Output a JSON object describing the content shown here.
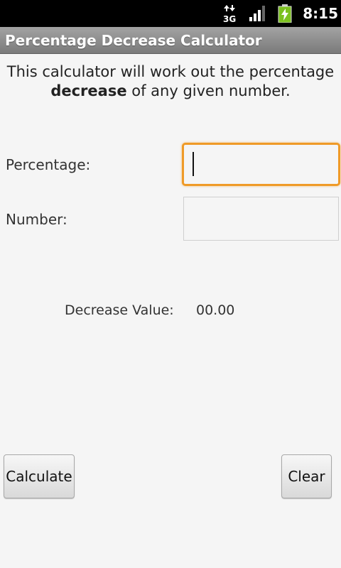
{
  "status_bar": {
    "network_label": "3G",
    "time": "8:15",
    "icons": [
      "data-arrows-icon",
      "signal-strength-icon",
      "battery-charging-icon"
    ],
    "battery_color": "#7cc11f"
  },
  "app": {
    "title": "Percentage Decrease Calculator"
  },
  "intro": {
    "text_before": "This calculator will work out the percentage",
    "emphasis": "decrease",
    "text_after": "of any given number."
  },
  "form": {
    "percentage_label": "Percentage:",
    "percentage_value": "",
    "number_label": "Number:",
    "number_value": "",
    "focus_color": "#ef9a27"
  },
  "result": {
    "label": "Decrease Value:",
    "value": "00.00"
  },
  "buttons": {
    "calculate_label": "Calculate",
    "clear_label": "Clear"
  }
}
